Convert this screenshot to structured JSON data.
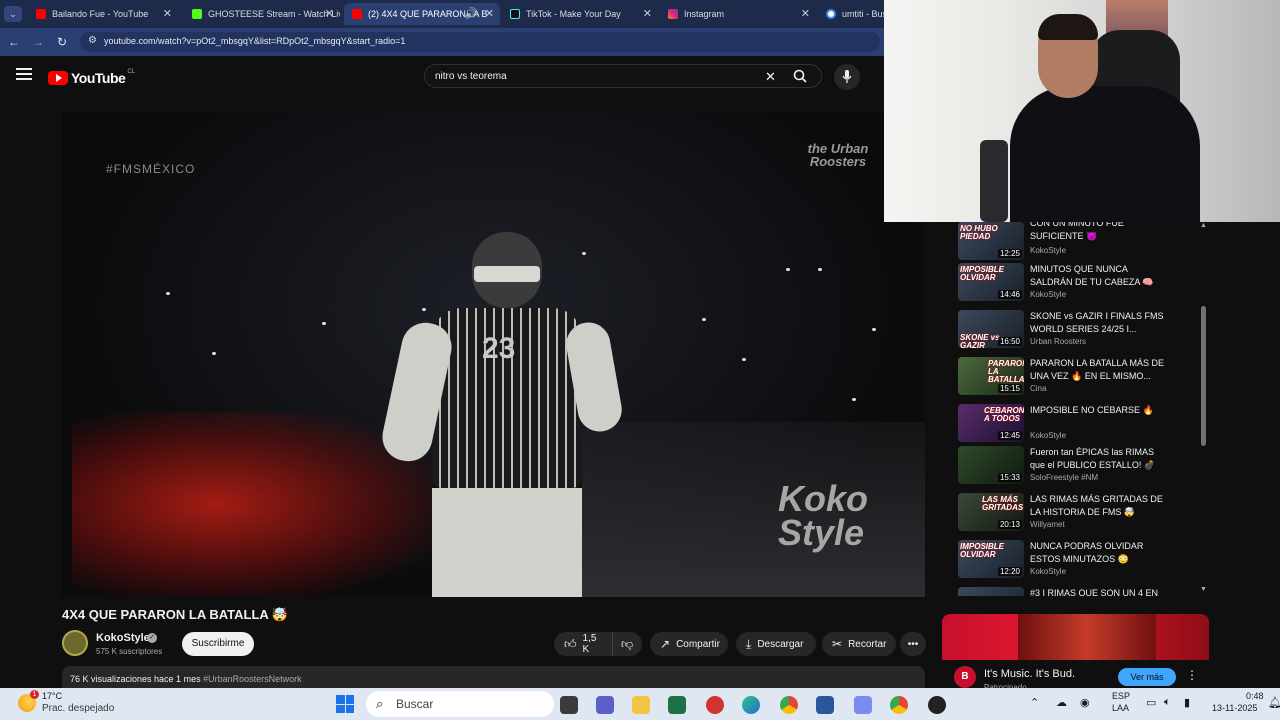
{
  "browser": {
    "tabs": [
      {
        "label": "Bailando Fue - YouTube",
        "color": "#ff0000"
      },
      {
        "label": "GHOSTEESE Stream - Watch Liv",
        "color": "#53fc18"
      },
      {
        "label": "(2) 4X4 QUE PARARON LA B",
        "color": "#ff0000",
        "active": true
      },
      {
        "label": "TikTok - Make Your Day",
        "color": "#111111"
      },
      {
        "label": "Instagram",
        "color": "#e1306c"
      },
      {
        "label": "umtiti - Bus",
        "color": "#4285f4"
      }
    ],
    "tab_menu_icon": "chevron-down-icon",
    "close_glyph": "✕",
    "url": "youtube.com/watch?v=pOt2_mbsgqY&list=RDpOt2_mbsgqY&start_radio=1"
  },
  "youtube": {
    "logo_text": "YouTube",
    "region": "CL",
    "search_query": "nitro vs teorema",
    "clear_glyph": "✕"
  },
  "video": {
    "watermark_fms": "#FMSMÉXICO",
    "watermark_urban": "the Urban Roosters",
    "watermark_koko": "Koko Style",
    "title": "4X4 QUE PARARON LA BATALLA 🤯",
    "channel": "KokoStyle",
    "subscribers": "575 K suscriptores",
    "subscribe_label": "Suscribirme",
    "likes": "1,5 K",
    "share_label": "Compartir",
    "download_label": "Descargar",
    "clip_label": "Recortar",
    "views_line": "76 K visualizaciones  hace 1 mes",
    "hashtag": "#UrbanRoostersNetwork"
  },
  "playlist": [
    {
      "thumb_text": "NO HUBO PIEDAD",
      "duration": "12:25",
      "title": "CON UN MINUTO FUE SUFICIENTE 😈",
      "channel": "KokoStyle"
    },
    {
      "thumb_text": "IMPOSIBLE OLVIDAR",
      "duration": "14:46",
      "title": "MINUTOS QUE NUNCA SALDRÁN DE TU CABEZA 🧠",
      "channel": "KokoStyle"
    },
    {
      "thumb_text": "SKONE vs GAZIR",
      "duration": "16:50",
      "title": "SKONE vs GAZIR I FINALS FMS WORLD SERIES 24/25 I...",
      "channel": "Urban Roosters"
    },
    {
      "thumb_text": "PARARON LA BATALLA",
      "duration": "15:15",
      "title": "PARARON LA BATALLA MÁS DE UNA VEZ 🔥 EN EL MISMO...",
      "channel": "Cina"
    },
    {
      "thumb_text": "CEBARON A TODOS",
      "duration": "12:45",
      "title": "IMPOSIBLE NO CEBARSE 🔥",
      "channel": "KokoStyle"
    },
    {
      "thumb_text": "",
      "duration": "15:33",
      "title": "Fueron tan ÉPICAS las RIMAS que el PUBLICO ESTALLO! 💣",
      "channel": "SoloFreestyle #NM"
    },
    {
      "thumb_text": "LAS MÁS GRITADAS",
      "duration": "20:13",
      "title": "LAS RIMAS MÁS GRITADAS DE LA HISTORIA DE FMS 🤯",
      "channel": "Willyamet"
    },
    {
      "thumb_text": "IMPOSIBLE OLVIDAR",
      "duration": "12:20",
      "title": "NUNCA PODRAS OLVIDAR ESTOS MINUTAZOS 😳",
      "channel": "KokoStyle"
    },
    {
      "thumb_text": "",
      "duration": "",
      "title": "#3 I RIMAS QUE SON UN 4 EN",
      "channel": ""
    }
  ],
  "ad": {
    "title": "It's Music. It's Bud.",
    "sponsor_label": "Patrocinado",
    "cta": "Ver más"
  },
  "taskbar": {
    "weather_temp": "17°C",
    "weather_desc": "Prac. despejado",
    "weather_badge": "1",
    "search_label": "Buscar",
    "lang1": "ESP",
    "lang2": "LAA",
    "time": "0:48",
    "date": "13-11-2025"
  },
  "colors": {
    "youtube_red": "#ff0000",
    "link_blue": "#3ea6ff",
    "ad_red": "#c8102e"
  }
}
